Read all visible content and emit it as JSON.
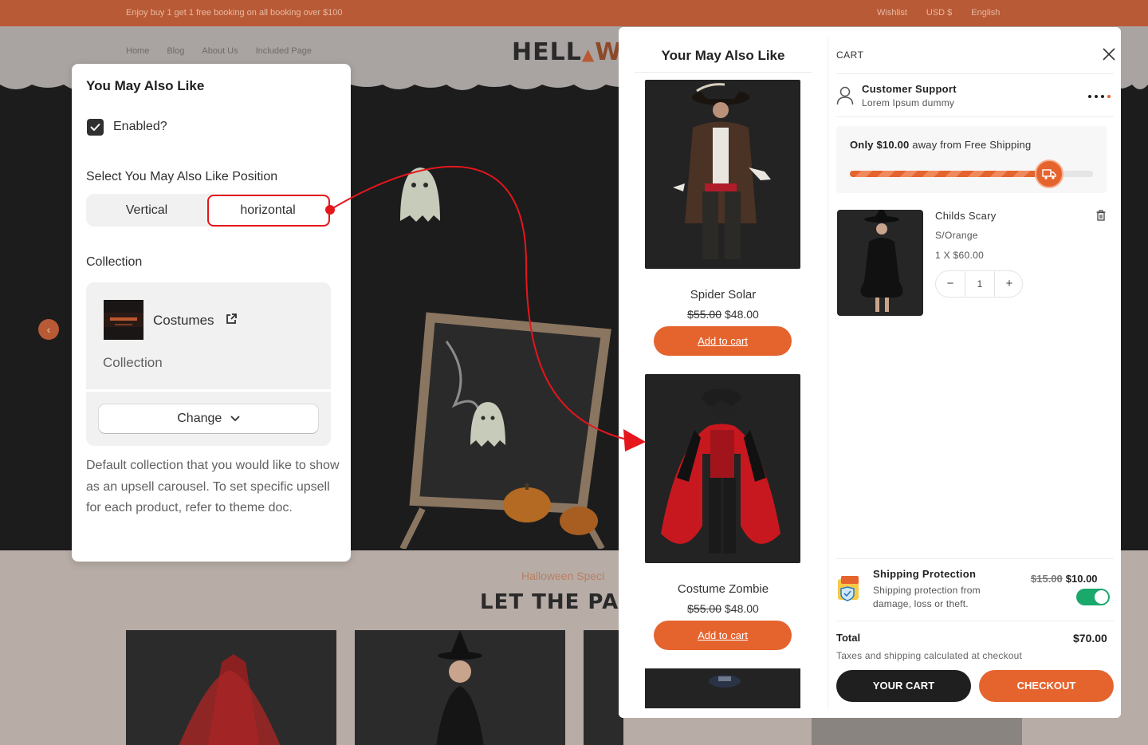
{
  "store": {
    "announcement": "Enjoy buy 1 get 1 free booking on all booking over $100",
    "wishlist": "Wishlist",
    "currency": "USD $",
    "language": "English",
    "nav": [
      "Home",
      "Blog",
      "About Us",
      "Included Page"
    ],
    "logo_text": "HELL",
    "logo_suffix": "WI",
    "section_eyebrow": "Halloween Speci",
    "section_heading": "LET THE PARTY B"
  },
  "settings": {
    "title": "You May Also Like",
    "enabled_label": "Enabled?",
    "enabled": true,
    "position_label": "Select You May Also Like Position",
    "position_options": [
      "Vertical",
      "horizontal"
    ],
    "position_selected": "horizontal",
    "collection_label": "Collection",
    "collection_name": "Costumes",
    "collection_type": "Collection",
    "change_label": "Change",
    "help_text": "Default collection that you would like to show as an upsell carousel. To set specific upsell for each product, refer to theme doc."
  },
  "upsell": {
    "title": "Your May Also Like",
    "products": [
      {
        "name": "Spider Solar",
        "compare_price": "$55.00",
        "price": "$48.00",
        "button": "Add to cart"
      },
      {
        "name": "Costume Zombie",
        "compare_price": "$55.00",
        "price": "$48.00",
        "button": "Add to cart"
      }
    ]
  },
  "cart": {
    "title": "CART",
    "support_title": "Customer Support",
    "support_subtitle": "Lorem Ipsum dummy",
    "shipping_amount": "Only $10.00",
    "shipping_rest": " away from Free Shipping",
    "shipping_progress": 0.82,
    "item": {
      "name": "Childs Scary",
      "variant": "S/Orange",
      "line": "1 X $60.00",
      "quantity": "1",
      "minus": "−",
      "plus": "+"
    },
    "protection": {
      "title": "Shipping Protection",
      "description": "Shipping protection from damage, loss or theft.",
      "compare_price": "$15.00",
      "price": "$10.00",
      "enabled": true
    },
    "total_label": "Total",
    "total_value": "$70.00",
    "tax_note": "Taxes and shipping calculated at checkout",
    "your_cart_label": "YOUR CART",
    "checkout_label": "CHECKOUT"
  },
  "colors": {
    "accent": "#e5642e",
    "annotation": "#e5161c",
    "toggle_on": "#1aa86b"
  }
}
